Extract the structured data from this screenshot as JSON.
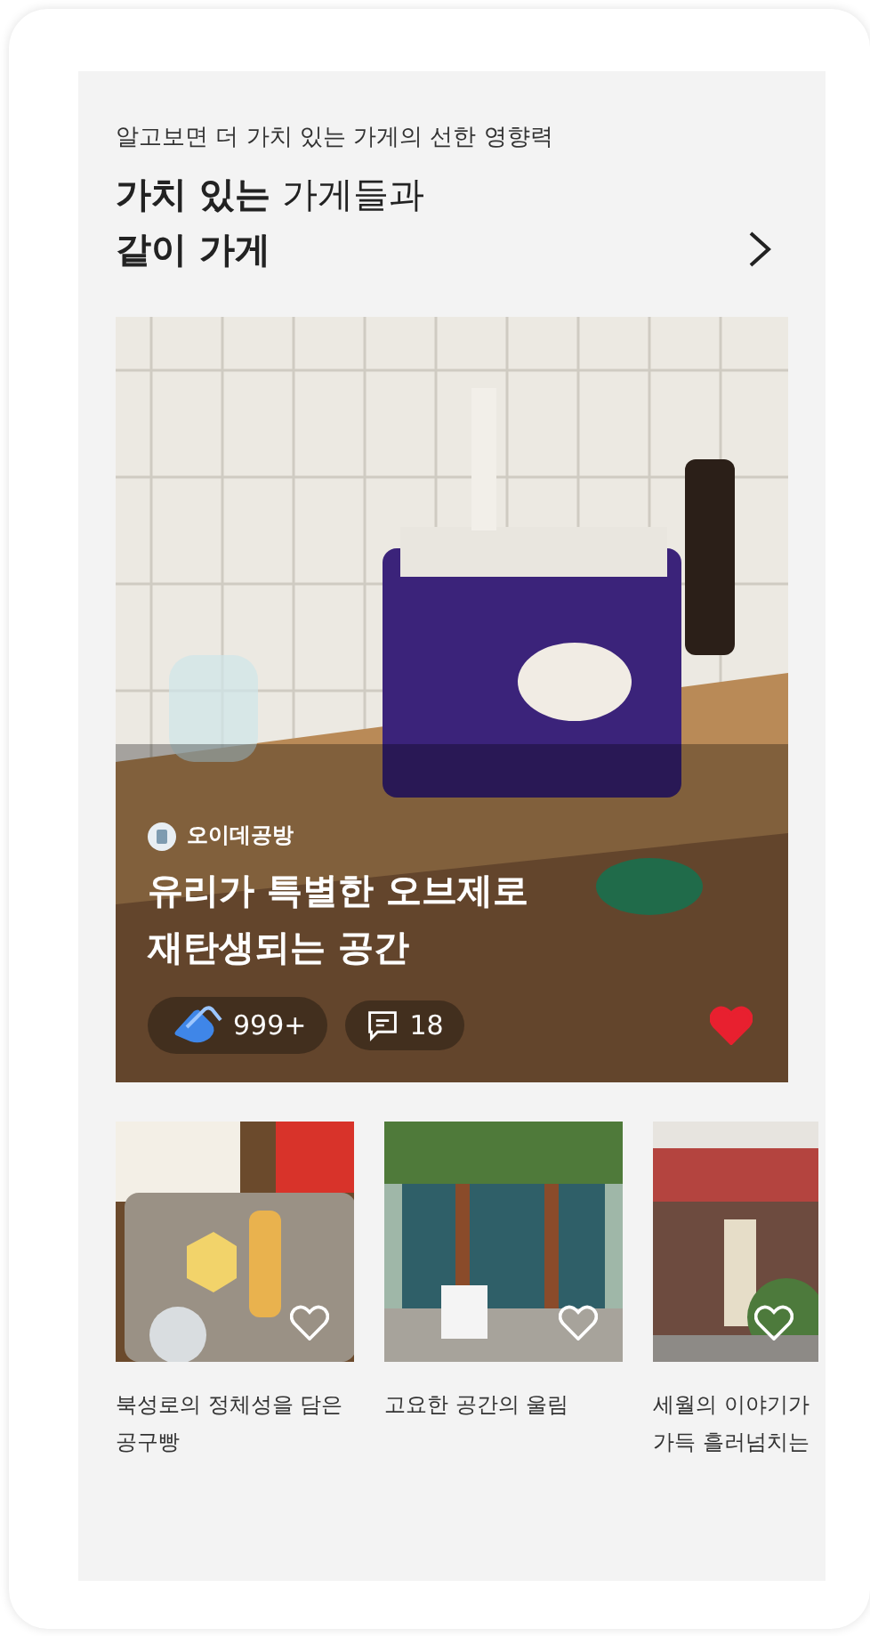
{
  "header": {
    "subtitle": "알고보면 더 가치 있는 가게의 선한 영향력",
    "title_line_1": "**가치 있는** 가게들과",
    "title_line_2": "같이 가게"
  },
  "featured": {
    "kind": "picture",
    "store": "오이데공방",
    "title": "유리가 특별한 오브제로 재탄생되는 공간",
    "claps": "999+",
    "comments": "18",
    "liked": true
  },
  "cards": [
    {
      "caption": "북성로의 정체성을 담은 공구빵",
      "liked": false,
      "kind": "picture"
    },
    {
      "caption": "고요한 공간의 울림",
      "liked": false,
      "kind": "picture"
    },
    {
      "caption": "세월의 이야기가 가득 흘러넘치는",
      "liked": false,
      "kind": "picture"
    }
  ]
}
